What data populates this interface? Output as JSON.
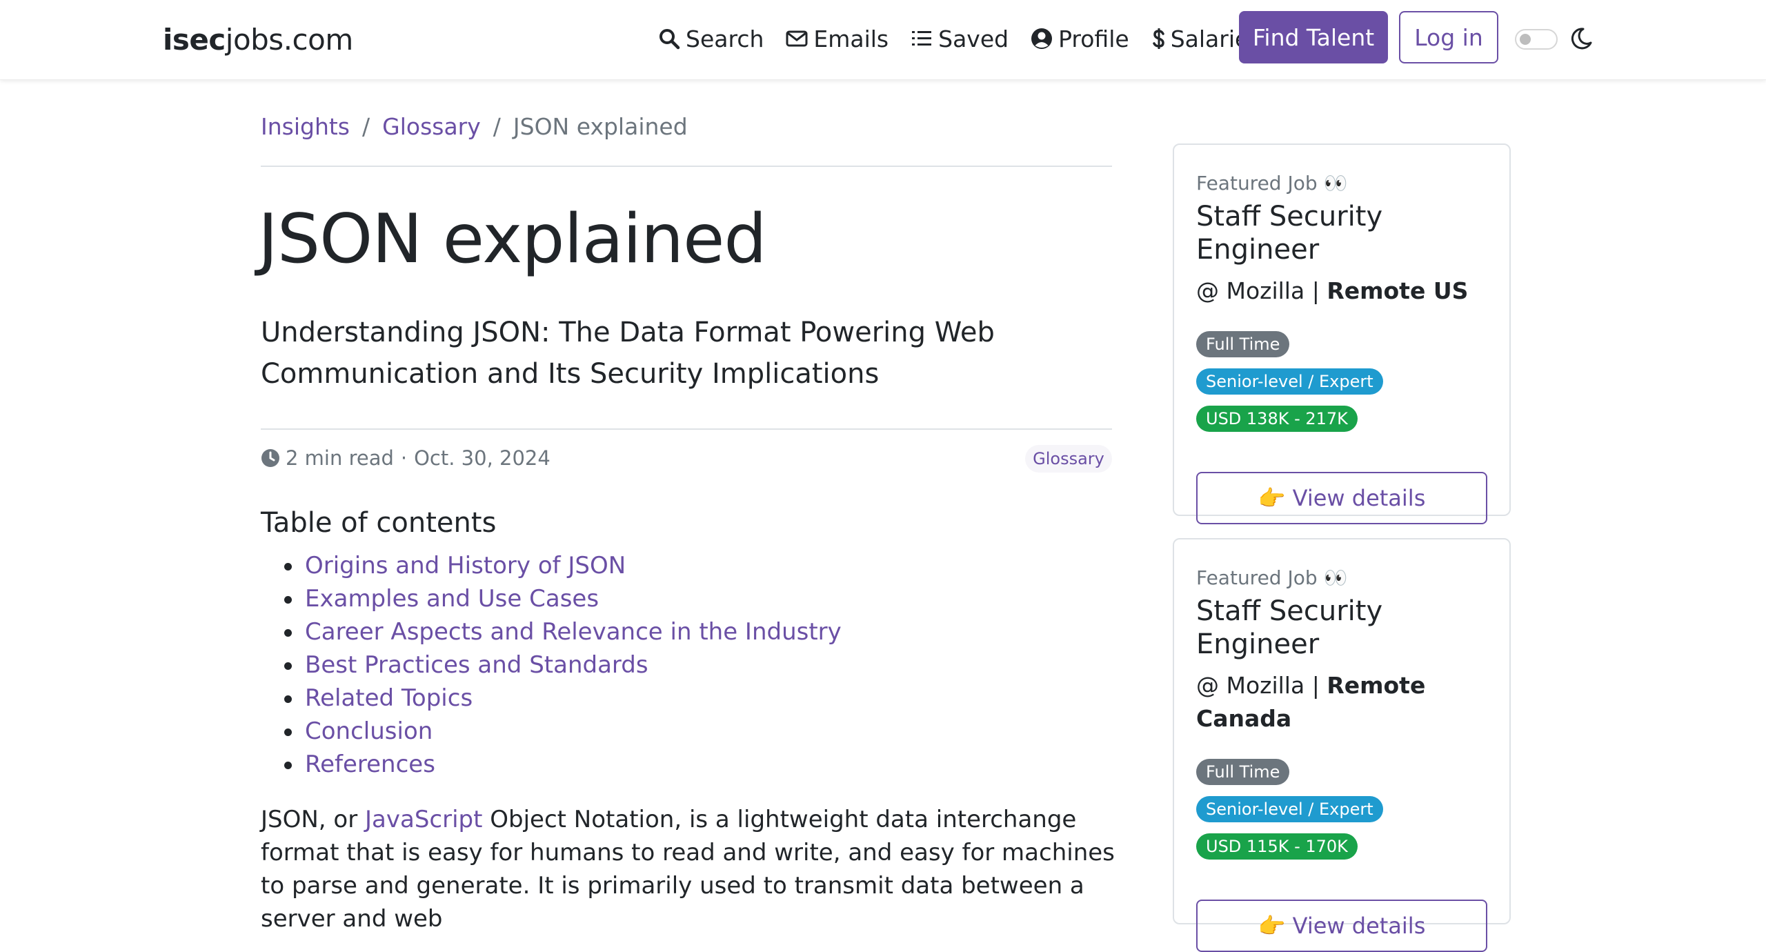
{
  "navbar": {
    "brand_bold": "isec",
    "brand_rest": "jobs.com",
    "links": [
      {
        "label": "Search",
        "icon": "search-icon"
      },
      {
        "label": "Emails",
        "icon": "envelope-icon"
      },
      {
        "label": "Saved",
        "icon": "list-icon"
      },
      {
        "label": "Profile",
        "icon": "user-circle-icon"
      },
      {
        "label": "Salaries",
        "icon": "dollar-icon"
      }
    ],
    "find_talent": "Find Talent",
    "login": "Log in",
    "dark_mode_icon": "moon-icon"
  },
  "breadcrumb": {
    "items": [
      "Insights",
      "Glossary"
    ],
    "current": "JSON explained",
    "separator": "/"
  },
  "article": {
    "title": "JSON explained",
    "subtitle": "Understanding JSON: The Data Format Powering Web Communication and Its Security Implications",
    "read_time": "2 min read",
    "meta_separator": "·",
    "date": "Oct. 30, 2024",
    "tag": "Glossary",
    "toc_title": "Table of contents",
    "toc": [
      "Origins and History of JSON",
      "Examples and Use Cases",
      "Career Aspects and Relevance in the Industry",
      "Best Practices and Standards",
      "Related Topics",
      "Conclusion",
      "References"
    ],
    "body_prefix": "JSON, or ",
    "body_link": "JavaScript",
    "body_rest": " Object Notation, is a lightweight data interchange format that is easy for humans to read and write, and easy for machines to parse and generate. It is primarily used to transmit data between a server and web"
  },
  "sidebar": {
    "cards": [
      {
        "label": "Featured Job 👀",
        "title": "Staff Security Engineer",
        "company": "@ Mozilla",
        "separator": "|",
        "location": "Remote US",
        "badges": [
          "Full Time",
          "Senior-level / Expert"
        ],
        "salary": "USD 138K - 217K",
        "button": "👉 View details"
      },
      {
        "label": "Featured Job 👀",
        "title": "Staff Security Engineer",
        "company": "@ Mozilla",
        "separator": "|",
        "location": "Remote Canada",
        "badges": [
          "Full Time",
          "Senior-level / Expert"
        ],
        "salary": "USD 115K - 170K",
        "button": "👉 View details"
      }
    ]
  },
  "colors": {
    "accent": "#6a4fa5",
    "badge_gray": "#6c757d",
    "badge_blue": "#1f9bcf",
    "badge_green": "#19a34a"
  }
}
